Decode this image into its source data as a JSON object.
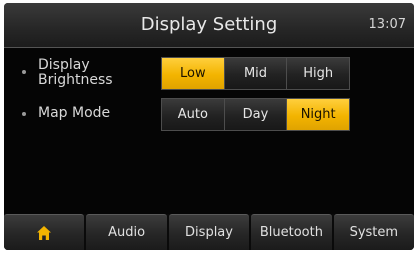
{
  "header": {
    "title": "Display Setting",
    "clock": "13:07"
  },
  "settings": {
    "brightness": {
      "label_line1": "Display",
      "label_line2": "Brightness",
      "options": [
        "Low",
        "Mid",
        "High"
      ],
      "selected": "Low"
    },
    "map_mode": {
      "label": "Map Mode",
      "options": [
        "Auto",
        "Day",
        "Night"
      ],
      "selected": "Night"
    }
  },
  "tabs": {
    "home_icon": "home-icon",
    "audio": "Audio",
    "display": "Display",
    "bluetooth": "Bluetooth",
    "system": "System"
  },
  "colors": {
    "accent": "#f3b400",
    "background": "#050505"
  }
}
